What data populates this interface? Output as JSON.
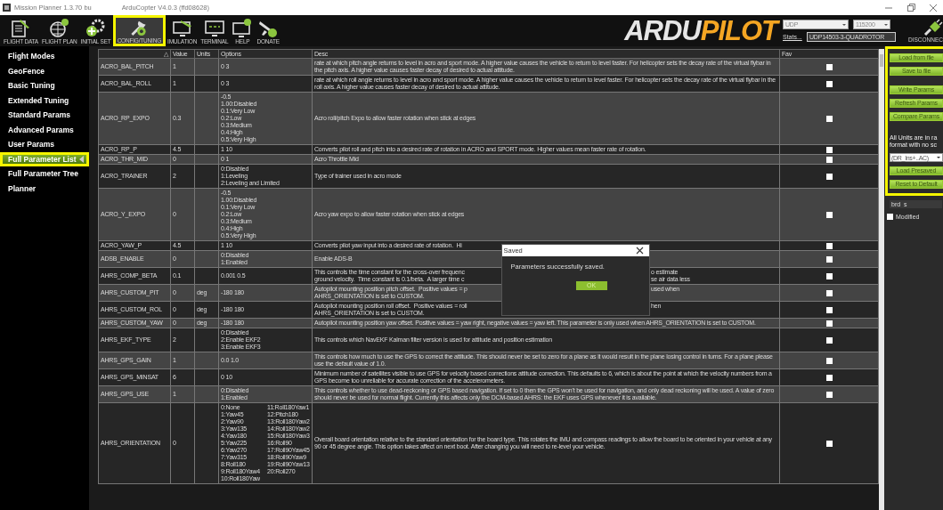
{
  "window": {
    "title_start": "Mission Planner 1.3.70 bu",
    "title_end": "ArduCopter V4.0.3 (ffd08628)"
  },
  "toolbar": {
    "items": [
      {
        "label": "FLIGHT DATA",
        "selected": false,
        "highlighted": false
      },
      {
        "label": "FLIGHT PLAN",
        "selected": false,
        "highlighted": false
      },
      {
        "label": "INITIAL SET",
        "selected": false,
        "highlighted": false
      },
      {
        "label": "CONFIG/TUNING",
        "selected": true,
        "highlighted": true
      },
      {
        "label": "IMULATION",
        "selected": false,
        "highlighted": false
      },
      {
        "label": "TERMINAL",
        "selected": false,
        "highlighted": false
      },
      {
        "label": "HELP",
        "selected": false,
        "highlighted": false
      },
      {
        "label": "DONATE",
        "selected": false,
        "highlighted": false
      }
    ]
  },
  "logo": {
    "part_1": "ARDU",
    "part_2": "PILOT"
  },
  "connection": {
    "port": "UDP",
    "baud": "115200",
    "stats_link": "Stats...",
    "vehicle": "UDP14503-3-QUADROTOR",
    "disconnect_label": "DISCONNEC"
  },
  "sidebar": {
    "items": [
      {
        "label": "Flight Modes",
        "selected": false,
        "highlighted": false
      },
      {
        "label": "GeoFence",
        "selected": false,
        "highlighted": false
      },
      {
        "label": "Basic Tuning",
        "selected": false,
        "highlighted": false
      },
      {
        "label": "Extended Tuning",
        "selected": false,
        "highlighted": false
      },
      {
        "label": "Standard Params",
        "selected": false,
        "highlighted": false
      },
      {
        "label": "Advanced Params",
        "selected": false,
        "highlighted": false
      },
      {
        "label": "User Params",
        "selected": false,
        "highlighted": false
      },
      {
        "label": "Full Parameter List",
        "selected": true,
        "highlighted": true
      },
      {
        "label": "Full Parameter Tree",
        "selected": false,
        "highlighted": false
      },
      {
        "label": "Planner",
        "selected": false,
        "highlighted": false
      }
    ]
  },
  "table": {
    "sort_glyph": "△",
    "columns": [
      "Value",
      "Units",
      "Options",
      "Desc",
      "Fav"
    ],
    "rows": [
      {
        "command": "ACRO_BAL_PITCH",
        "value": "1",
        "options": [
          "0 3"
        ],
        "desc": "rate at which pitch angle returns to level in acro and sport mode.  A higher value causes the vehicle to return to level faster. For helicopter sets the decay rate of the virtual flybar in the pitch axis. A higher value causes faster decay of desired to actual attitude.",
        "fav": false
      },
      {
        "command": "ACRO_BAL_ROLL",
        "value": "1",
        "options": [
          "0 3"
        ],
        "desc": "rate at which roll angle returns to level in acro and sport mode.  A higher value causes the vehicle to return to level faster. For helicopter sets the decay rate of the virtual flybar in the roll axis. A higher value causes faster decay of desired to actual attitude.",
        "fav": false
      },
      {
        "command": "ACRO_RP_EXPO",
        "value": "0.3",
        "options": [
          "-0.5",
          "1.00:Disabled",
          "0.1:Very Low",
          "0.2:Low",
          "0.3:Medium",
          "0.4:High",
          "0.5:Very High"
        ],
        "desc": "Acro roll/pitch Expo to allow faster rotation when stick at edges",
        "fav": false
      },
      {
        "command": "ACRO_RP_P",
        "value": "4.5",
        "options": [
          "1 10"
        ],
        "desc": "Converts pilot roll and pitch into a desired rate of rotation in ACRO and SPORT mode.  Higher values mean faster rate of rotation.",
        "fav": false
      },
      {
        "command": "ACRO_THR_MID",
        "value": "0",
        "options": [
          "0 1"
        ],
        "desc": "Acro Throttle Mid",
        "fav": false
      },
      {
        "command": "ACRO_TRAINER",
        "value": "2",
        "options": [
          "0:Disabled",
          "1:Leveling",
          "2:Leveling and Limited"
        ],
        "desc": "Type of trainer used in acro mode",
        "fav": false
      },
      {
        "command": "ACRO_Y_EXPO",
        "value": "0",
        "options": [
          "-0.5",
          "1.00:Disabled",
          "0.1:Very Low",
          "0.2:Low",
          "0.3:Medium",
          "0.4:High",
          "0.5:Very High"
        ],
        "desc": "Acro yaw expo to allow faster rotation when stick at edges",
        "fav": false
      },
      {
        "command": "ACRO_YAW_P",
        "value": "4.5",
        "options": [
          "1 10"
        ],
        "desc_left": [
          "Converts pilot yaw input into a desired rate of rotation.  Hi"
        ],
        "fav": false
      },
      {
        "command": "ADSB_ENABLE",
        "value": "0",
        "options": [
          "0:Disabled",
          "1:Enabled"
        ],
        "desc": "Enable ADS-B",
        "fav": false
      },
      {
        "command": "AHRS_COMP_BETA",
        "value": "0.1",
        "options": [
          "0.001 0.5"
        ],
        "desc_left": [
          "This controls the time constant for the cross-over frequenc",
          "ground velocity.  Time constant is 0.1/beta.  A larger time c"
        ],
        "desc_right": [
          "o estimate",
          "se air data less"
        ],
        "fav": false
      },
      {
        "command": "AHRS_CUSTOM_PIT",
        "value": "0",
        "units": "deg",
        "options": [
          "-180 180"
        ],
        "desc_left": [
          "Autopilot mounting position pitch offset.  Positive values = p",
          "AHRS_ORIENTATION is set to CUSTOM."
        ],
        "desc_right": [
          "used when"
        ],
        "fav": false
      },
      {
        "command": "AHRS_CUSTOM_ROL",
        "value": "0",
        "units": "deg",
        "options": [
          "-180 180"
        ],
        "desc_left": [
          "Autopilot mounting position roll offset.  Positive values = roll",
          "AHRS_ORIENTATION is set to CUSTOM."
        ],
        "desc_right": [
          "hen"
        ],
        "fav": false
      },
      {
        "command": "AHRS_CUSTOM_YAW",
        "value": "0",
        "units": "deg",
        "options": [
          "-180 180"
        ],
        "desc": "Autopilot mounting position yaw offset. Positive values = yaw right, negative values = yaw left. This parameter is only used when AHRS_ORIENTATION is set to CUSTOM.",
        "fav": false
      },
      {
        "command": "AHRS_EKF_TYPE",
        "value": "2",
        "options": [
          "0:Disabled",
          "2:Enable EKF2",
          "3:Enable EKF3"
        ],
        "desc": "This controls which NavEKF Kalman filter version is used for attitude and position estimation",
        "fav": false
      },
      {
        "command": "AHRS_GPS_GAIN",
        "value": "1",
        "options": [
          "0.0 1.0"
        ],
        "desc": "This controls how much to use the GPS to correct the attitude.  This should never be set to zero for a plane as it would result in the plane losing control in turns. For a plane please use the default value of 1.0.",
        "fav": false
      },
      {
        "command": "AHRS_GPS_MINSAT",
        "value": "6",
        "options": [
          "0 10"
        ],
        "desc": "Minimum number of satellites visible to use GPS for velocity based corrections attitude correction. This defaults to 6, which is about the point at which the velocity numbers from a GPS become too unreliable for accurate correction of the accelerometers.",
        "fav": false
      },
      {
        "command": "AHRS_GPS_USE",
        "value": "1",
        "options": [
          "0:Disabled",
          "1:Enabled"
        ],
        "desc": "This controls whether to use dead-reckoning or GPS based navigation. If set to 0 then the GPS won't be used for navigation, and only dead reckoning will be used. A value of zero should never be used for normal flight. Currently this affects only the DCM-based AHRS: the EKF uses GPS whenever it is available.",
        "fav": false
      },
      {
        "command": "AHRS_ORIENTATION",
        "value": "0",
        "options": [
          "0:None",
          "1:Yaw45",
          "2:Yaw90",
          "3:Yaw135",
          "4:Yaw180",
          "5:Yaw225",
          "6:Yaw270",
          "7:Yaw315",
          "8:Roll180",
          "9:Roll180Yaw4",
          "10:Roll180Yaw",
          "11:Roll180Yaw1",
          "12:Pitch180",
          "13:Roll180Yaw2",
          "14:Roll180Yaw2",
          "15:Roll180Yaw3",
          "16:Roll90",
          "17:Roll90Yaw45",
          "18:Roll90Yaw9",
          "19:Roll90Yaw13",
          "20:Roll270"
        ],
        "desc": "Overall board orientation relative to the standard orientation for the board type. This rotates the IMU and compass readings to allow the board to be oriented in your vehicle at any 90 or 45 degree angle. This option takes affect on next boot. After changing you will need to re-level your vehicle.",
        "fav": false
      }
    ]
  },
  "dialog": {
    "title": "Saved",
    "message": "Parameters successfully saved.",
    "button": "OK"
  },
  "side_panel": {
    "highlighted": true,
    "buttons_top": [
      "Load from file",
      "Save to file",
      "Write Params",
      "Refresh Params",
      "Compare Params"
    ],
    "note_lines": [
      "All Units are in ra",
      "format with no sc"
    ],
    "filter_value": "(DR_Ins+..AC)",
    "buttons_bottom": [
      "Load Presaved",
      "Reset to Default"
    ],
    "search_value": "brd_s",
    "modified": {
      "label": "Modified",
      "checked": false
    }
  }
}
